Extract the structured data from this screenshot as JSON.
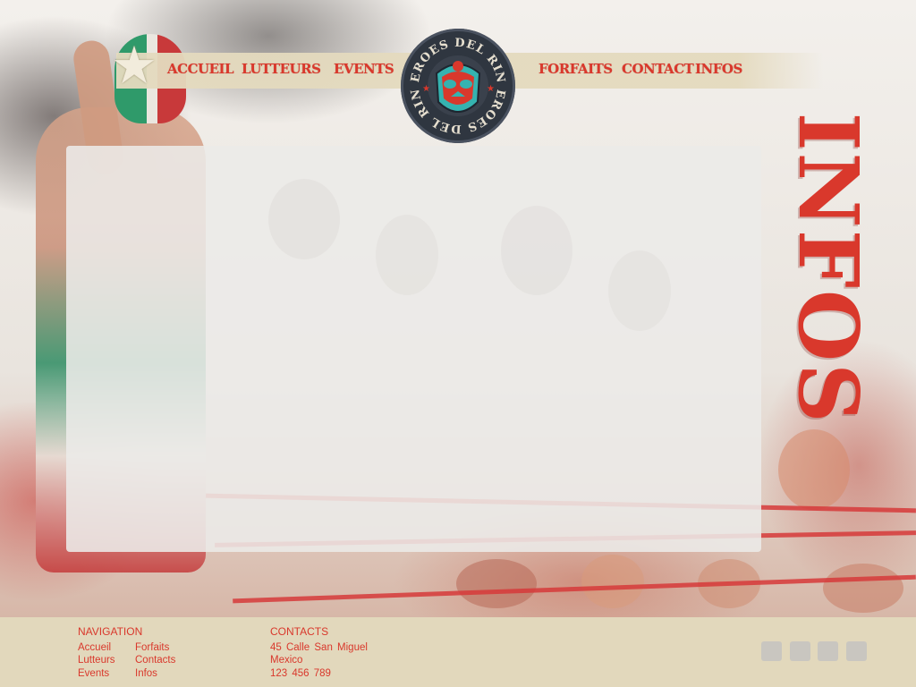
{
  "brand": {
    "logo_text_top": "HEROES DEL RING",
    "logo_text_bottom": "HEROES DEL RING"
  },
  "nav": {
    "items": [
      "ACCUEIL",
      "LUTTEURS",
      "EVENTS",
      "FORFAITS",
      "CONTACT",
      "INFOS"
    ]
  },
  "page": {
    "title": "INFOS"
  },
  "footer": {
    "navigation_heading": "NAVIGATION",
    "navigation_links": [
      "Accueil",
      "Lutteurs",
      "Events",
      "Forfaits",
      "Contacts",
      "Infos"
    ],
    "contacts_heading": "CONTACTS",
    "address_line1": "45 Calle San Miguel",
    "address_line2": "Mexico",
    "phone": "123 456 789"
  },
  "social": {
    "icons": [
      "social-icon-1",
      "social-icon-2",
      "social-icon-3",
      "social-icon-4"
    ]
  },
  "colors": {
    "accent": "#d9382c",
    "nav_bg": "#e4dabe",
    "footer_bg": "#e2d8bc",
    "logo_teal": "#35b3b0"
  }
}
